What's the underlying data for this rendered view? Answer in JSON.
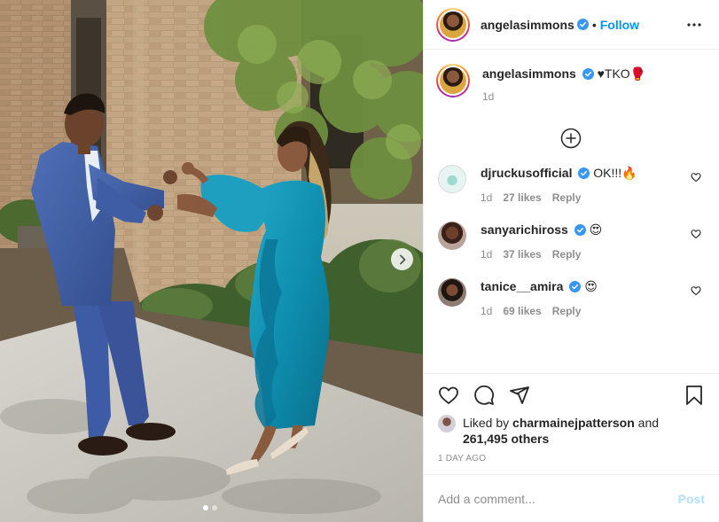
{
  "post": {
    "author": "angelasimmons",
    "follow_label": "Follow",
    "bullet": "•",
    "more_icon": "more-options-icon",
    "image_count": 2,
    "active_image": 1
  },
  "caption": {
    "username": "angelasimmons",
    "text": "♥TKO🥊",
    "time": "1d"
  },
  "load_more_icon": "plus-circle-icon",
  "comments": [
    {
      "username": "djruckusofficial",
      "text": "OK!!!🔥",
      "time": "1d",
      "likes": "27 likes",
      "reply": "Reply",
      "verified": true
    },
    {
      "username": "sanyarichiross",
      "text": "😍",
      "time": "1d",
      "likes": "37 likes",
      "reply": "Reply",
      "verified": true
    },
    {
      "username": "tanice__amira",
      "text": "😍",
      "time": "1d",
      "likes": "69 likes",
      "reply": "Reply",
      "verified": true
    }
  ],
  "liked_by": {
    "prefix": "Liked by ",
    "user": "charmainejpatterson",
    "and": " and",
    "others": "261,495 others"
  },
  "time_ago": "1 DAY AGO",
  "add_comment": {
    "placeholder": "Add a comment...",
    "post_label": "Post"
  },
  "colors": {
    "accent": "#0095f6",
    "verified": "#3897f0",
    "muted": "#8e8e8e",
    "post_disabled": "#b2dffc"
  }
}
